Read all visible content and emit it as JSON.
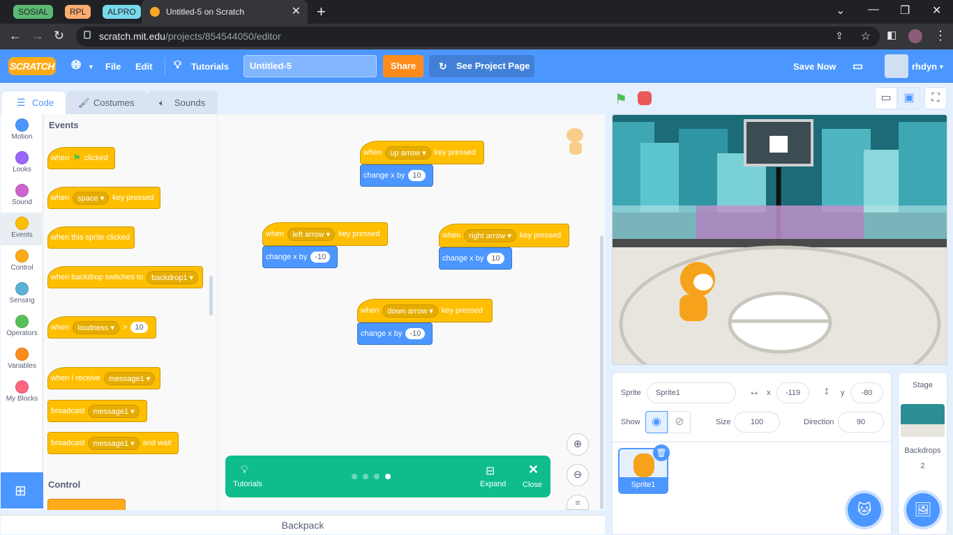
{
  "browser": {
    "tab_groups": [
      {
        "label": "SOSIAL",
        "color": "#5bb974",
        "text": "#202124"
      },
      {
        "label": "RPL",
        "color": "#fcad70",
        "text": "#202124"
      },
      {
        "label": "ALPRO",
        "color": "#78d9ec",
        "text": "#202124"
      }
    ],
    "active_tab_title": "Untitled-5 on Scratch",
    "new_tab": "+",
    "close_tab": "✕",
    "url_domain": "scratch.mit.edu",
    "url_path": "/projects/854544050/editor"
  },
  "menu": {
    "logo": "SCRATCH",
    "file": "File",
    "edit": "Edit",
    "tutorials": "Tutorials",
    "project_title": "Untitled-5",
    "share": "Share",
    "see_project": "See Project Page",
    "save_now": "Save Now",
    "username": "rhdyn"
  },
  "tabs": {
    "code": "Code",
    "costumes": "Costumes",
    "sounds": "Sounds"
  },
  "categories": [
    {
      "label": "Motion",
      "color": "#4c97ff"
    },
    {
      "label": "Looks",
      "color": "#9966ff"
    },
    {
      "label": "Sound",
      "color": "#cf63cf"
    },
    {
      "label": "Events",
      "color": "#ffbf00"
    },
    {
      "label": "Control",
      "color": "#ffab19"
    },
    {
      "label": "Sensing",
      "color": "#5cb1d6"
    },
    {
      "label": "Operators",
      "color": "#59c059"
    },
    {
      "label": "Variables",
      "color": "#ff8c1a"
    },
    {
      "label": "My Blocks",
      "color": "#ff6680"
    }
  ],
  "palette": {
    "events_heading": "Events",
    "control_heading": "Control",
    "when": "when",
    "clicked": "clicked",
    "key_pressed": "key pressed",
    "space": "space",
    "this_sprite_clicked": "when this sprite clicked",
    "backdrop_switches": "when backdrop switches to",
    "backdrop1": "backdrop1",
    "loudness": "loudness",
    "gt": ">",
    "ten": "10",
    "when_i_receive": "when I receive",
    "message1": "message1",
    "broadcast": "broadcast",
    "and_wait": "and wait"
  },
  "scripts": [
    {
      "key": "up arrow",
      "change_label": "change x by",
      "value": "10"
    },
    {
      "key": "left arrow",
      "change_label": "change x by",
      "value": "-10"
    },
    {
      "key": "right arrow",
      "change_label": "change x by",
      "value": "10"
    },
    {
      "key": "down arrow",
      "change_label": "change x by",
      "value": "-10"
    }
  ],
  "tutorial_bar": {
    "tutorials": "Tutorials",
    "expand": "Expand",
    "close": "Close",
    "pages": 4,
    "current_page": 4
  },
  "backpack": "Backpack",
  "sprite_info": {
    "sprite_label": "Sprite",
    "sprite_name": "Sprite1",
    "x_label": "x",
    "x": "-119",
    "y_label": "y",
    "y": "-80",
    "show_label": "Show",
    "size_label": "Size",
    "size": "100",
    "direction_label": "Direction",
    "direction": "90"
  },
  "sprite_thumb": "Sprite1",
  "stage_panel": {
    "title": "Stage",
    "backdrops_label": "Backdrops",
    "backdrops_count": "2"
  }
}
